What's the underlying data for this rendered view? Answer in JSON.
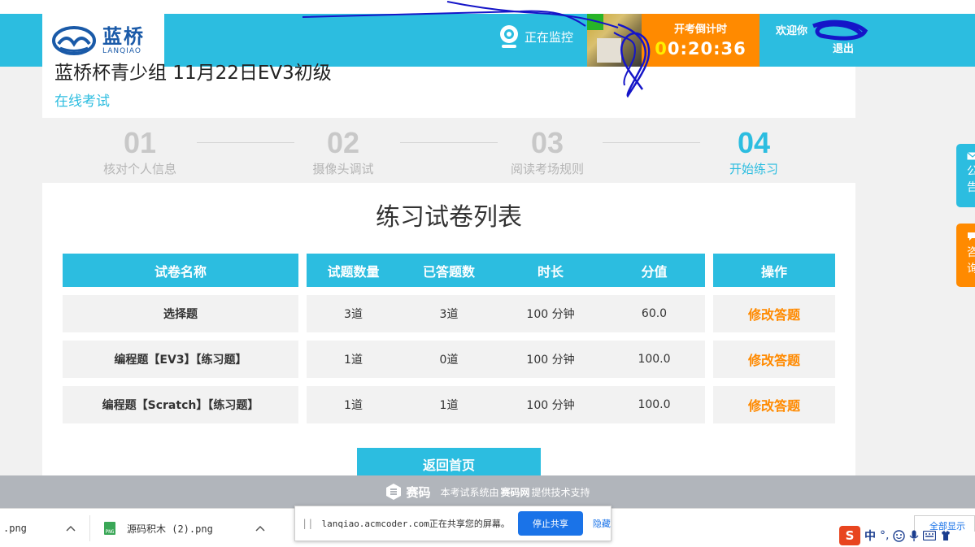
{
  "header": {
    "logo_cn": "蓝桥",
    "logo_en": "LANQIAO",
    "monitor_label": "正在监控",
    "countdown_label": "开考倒计时",
    "countdown_first": "0",
    "countdown_rest": "0:20:36",
    "welcome": "欢迎你",
    "logout": "退出"
  },
  "exam": {
    "title": "蓝桥杯青少组 11月22日EV3初级",
    "subtitle": "在线考试"
  },
  "steps": [
    {
      "num": "01",
      "label": "核对个人信息",
      "active": false
    },
    {
      "num": "02",
      "label": "摄像头调试",
      "active": false
    },
    {
      "num": "03",
      "label": "阅读考场规则",
      "active": false
    },
    {
      "num": "04",
      "label": "开始练习",
      "active": true
    }
  ],
  "list_title": "练习试卷列表",
  "table": {
    "headers": [
      "试卷名称",
      "试题数量",
      "已答题数",
      "时长",
      "分值",
      "操作"
    ],
    "rows": [
      {
        "name": "选择题",
        "count": "3道",
        "answered": "3道",
        "duration": "100 分钟",
        "score": "60.0",
        "action": "修改答题"
      },
      {
        "name": "编程题【EV3】【练习题】",
        "count": "1道",
        "answered": "0道",
        "duration": "100 分钟",
        "score": "100.0",
        "action": "修改答题"
      },
      {
        "name": "编程题【Scratch】【练习题】",
        "count": "1道",
        "answered": "1道",
        "duration": "100 分钟",
        "score": "100.0",
        "action": "修改答题"
      }
    ]
  },
  "back_button": "返回首页",
  "side_tabs": {
    "notice": [
      "公",
      "告"
    ],
    "consult": [
      "咨",
      "询"
    ]
  },
  "footer": {
    "brand": "赛码",
    "text_before": "本考试系统由",
    "text_brand": "赛码网",
    "text_after": "提供技术支持"
  },
  "downloads": {
    "item1": ".png",
    "item2": "源码积木 (2).png",
    "show_all": "全部显示"
  },
  "share": {
    "message": "lanqiao.acmcoder.com正在共享您的屏幕。",
    "stop": "停止共享",
    "hide": "隐藏"
  },
  "ime": {
    "zh": "中",
    "punct": "°,"
  },
  "colors": {
    "primary": "#2cbde0",
    "accent": "#ff8a00",
    "header_bg": "#2cbde0",
    "footer_bg": "#b1b5bb"
  }
}
